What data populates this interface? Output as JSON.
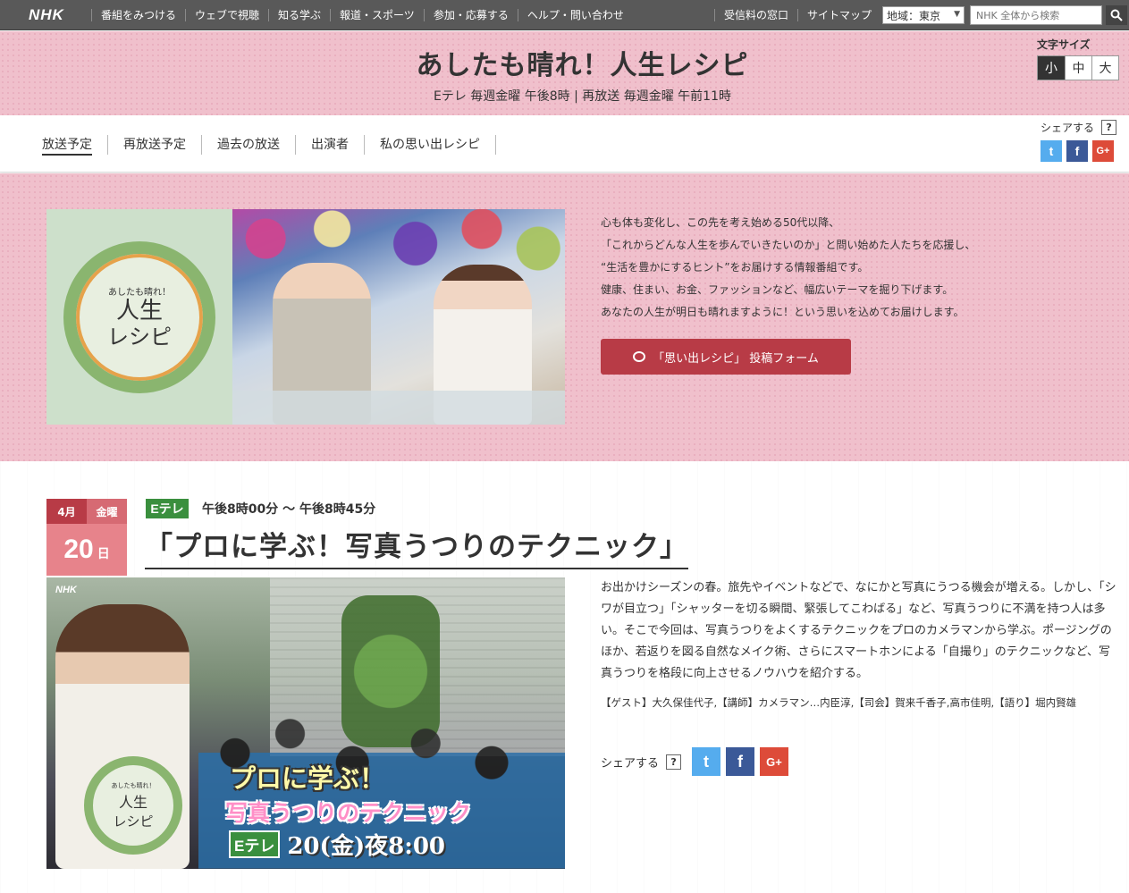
{
  "nhk": {
    "logo": "NHK",
    "nav": [
      "番組をみつける",
      "ウェブで視聴",
      "知る学ぶ",
      "報道・スポーツ",
      "参加・応募する",
      "ヘルプ・問い合わせ"
    ],
    "right": [
      "受信料の窓口",
      "サイトマップ"
    ],
    "region": "地域：東京",
    "search_placeholder": "NHK 全体から検索"
  },
  "header": {
    "title": "あしたも晴れ！人生レシピ",
    "subtitle": "Eテレ 毎週金曜 午後8時 | 再放送 毎週金曜 午前11時",
    "font_size_label": "文字サイズ",
    "font_sizes": [
      "小",
      "中",
      "大"
    ]
  },
  "subnav": {
    "items": [
      "放送予定",
      "再放送予定",
      "過去の放送",
      "出演者",
      "私の思い出レシピ"
    ],
    "share_label": "シェアする",
    "help": "?"
  },
  "hero": {
    "logo_small": "あしたも晴れ！",
    "logo_line1": "人生",
    "logo_line2": "レシピ",
    "description": [
      "心も体も変化し、この先を考え始める50代以降、",
      "「これからどんな人生を歩んでいきたいのか」と問い始めた人たちを応援し、",
      "“生活を豊かにするヒント”をお届けする情報番組です。",
      "健康、住まい、お金、ファッションなど、幅広いテーマを掘り下げます。",
      "あなたの人生が明日も晴れますように！という思いを込めてお届けします。"
    ],
    "form_button": "「思い出レシピ」 投稿フォーム"
  },
  "episode": {
    "month": "4月",
    "weekday": "金曜",
    "day": "20",
    "day_label": "日",
    "channel": "Eテレ",
    "time": "午後8時00分 ～ 午後8時45分",
    "title": "「プロに学ぶ！写真うつりのテクニック」",
    "image": {
      "nhk_mark": "NHK",
      "logo_small": "あしたも晴れ！",
      "logo_line1": "人生",
      "logo_line2": "レシピ",
      "caption1": "プロに学ぶ！",
      "caption2": "写真うつりのテクニック",
      "caption_channel": "Eテレ",
      "caption_time": "20(金)夜8:00"
    },
    "description": "お出かけシーズンの春。旅先やイベントなどで、なにかと写真にうつる機会が増える。しかし、「シワが目立つ」「シャッターを切る瞬間、緊張してこわばる」など、写真うつりに不満を持つ人は多い。そこで今回は、写真うつりをよくするテクニックをプロのカメラマンから学ぶ。ポージングのほか、若返りを図る自然なメイク術、さらにスマートホンによる「自撮り」のテクニックなど、写真うつりを格段に向上させるノウハウを紹介する。",
    "credits": "【ゲスト】大久保佳代子,【講師】カメラマン…内臣淳,【司会】賀来千香子,高市佳明,【語り】堀内賢雄",
    "share_label": "シェアする",
    "help": "?"
  },
  "share_icons": {
    "twitter": "t",
    "facebook": "f",
    "google": "G+"
  },
  "colors": {
    "pink_bg": "#f0c0cc",
    "accent_red": "#b83b46",
    "eterebi_green": "#3a8f3e",
    "topbar": "#595959"
  }
}
